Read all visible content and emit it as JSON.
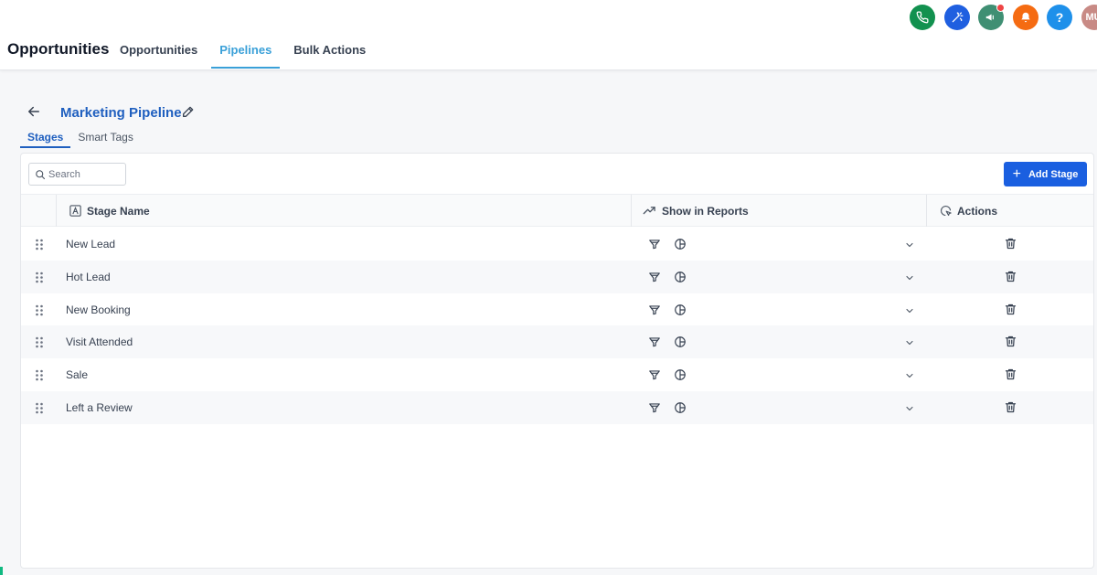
{
  "header": {
    "app_title": "Opportunities",
    "tabs": [
      {
        "label": "Opportunities",
        "active": false
      },
      {
        "label": "Pipelines",
        "active": true
      },
      {
        "label": "Bulk Actions",
        "active": false
      }
    ],
    "icons": [
      {
        "name": "phone-icon",
        "color": "#12914f"
      },
      {
        "name": "magic-wand-icon",
        "color": "#1f5fe0"
      },
      {
        "name": "megaphone-icon",
        "color": "#3f8f73",
        "notification": true
      },
      {
        "name": "bell-icon",
        "color": "#f56b12"
      },
      {
        "name": "help-icon",
        "color": "#1e90ea",
        "glyph": "?"
      }
    ],
    "avatar_initials": "MU",
    "avatar_color": "#c88a85"
  },
  "pipeline": {
    "title": "Marketing Pipeline",
    "sub_tabs": [
      {
        "label": "Stages",
        "active": true
      },
      {
        "label": "Smart Tags",
        "active": false
      }
    ]
  },
  "toolbar": {
    "search_placeholder": "Search",
    "add_stage_label": "Add Stage"
  },
  "table": {
    "columns": {
      "stage_name": "Stage Name",
      "show_in_reports": "Show in Reports",
      "actions": "Actions"
    },
    "rows": [
      {
        "name": "New Lead"
      },
      {
        "name": "Hot Lead"
      },
      {
        "name": "New Booking"
      },
      {
        "name": "Visit Attended"
      },
      {
        "name": "Sale"
      },
      {
        "name": "Left a Review"
      }
    ]
  },
  "colors": {
    "accent": "#1f5fbf",
    "nav_active": "#3aa0d8",
    "primary_button": "#1a5fe0"
  }
}
